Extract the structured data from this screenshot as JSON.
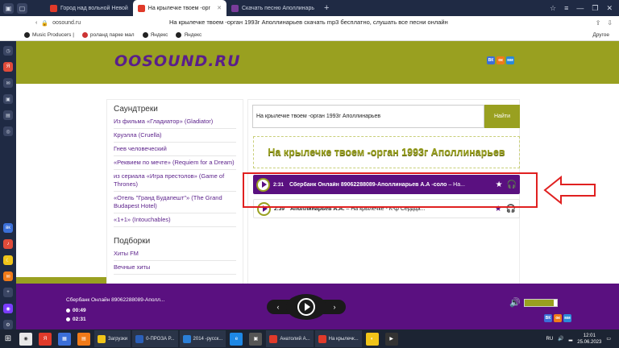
{
  "browser": {
    "tabs": [
      {
        "label": "Город над вольной Невой",
        "color": "#e03a2a"
      },
      {
        "label": "На крылечке твоем -орг",
        "color": "#e03a2a",
        "active": true
      },
      {
        "label": "Скачать песню Аполлинарь",
        "color": "#7a3c9a"
      }
    ],
    "new_tab": "+",
    "url": "oosound.ru",
    "page_title": "На крылечке твоем -орган 1993г Аполлинарьев скачать mp3 бесплатно, слушать все песни онлайн",
    "bookmarks": [
      "Music Producers |",
      "роланд парке мал",
      "Яндекс",
      "Яндекс"
    ],
    "other_bookmarks": "Другое"
  },
  "site": {
    "logo": "OOSOUND.RU",
    "socials": [
      {
        "label": "ВК",
        "color": "#3b6fd8"
      },
      {
        "label": "ок",
        "color": "#f07a19"
      },
      {
        "label": "мм",
        "color": "#2a8ad8"
      }
    ]
  },
  "sidebar": {
    "heading1": "Саундтреки",
    "items1": [
      "Из фильма «Гладиатор» (Gladiator)",
      "Круэлла (Cruella)",
      "Гнев человеческий",
      "«Реквием по мечте» (Requiem for a Dream)",
      "из сериала «Игра престолов» (Game of Thrones)",
      "«Отель \"Гранд Будапешт\"» (The Grand Budapest Hotel)",
      "«1+1» (Intouchables)"
    ],
    "heading2": "Подборки",
    "items2": [
      "Хиты FM",
      "Вечные хиты"
    ]
  },
  "search": {
    "value": "На крылечке твоем -орган 1993г Аполлинарьев",
    "button": "Найти"
  },
  "page_heading": "На крылечке твоем -орган 1993г Аполлинарьев",
  "tracks": [
    {
      "duration": "2:31",
      "title_bold": "Сбербанк Онлайн 89062288089-Аполлинарьев А.А -соло",
      "title_rest": " – На..."
    },
    {
      "duration": "2:39",
      "title_bold": "Аполлинарьев А.А.",
      "title_rest": " – На крылечке - К-ф Сердца..."
    }
  ],
  "player": {
    "now_playing": "Сбербанк Онлайн 89062288089-Аполл...",
    "elapsed": "00:49",
    "total": "02:31",
    "volume": 0.9
  },
  "taskbar": {
    "apps": [
      {
        "label": "Загрузки",
        "color": "#f0c419"
      },
      {
        "label": "0-ПРОЗА Р...",
        "color": "#2b5fb8"
      },
      {
        "label": "2014 -русск...",
        "color": "#2b7fd8"
      },
      {
        "label": "Анатолий А...",
        "color": "#e03a2a"
      },
      {
        "label": "На крылечк...",
        "color": "#e03a2a"
      }
    ],
    "lang": "RU",
    "time": "12:01",
    "date": "25.06.2023"
  }
}
